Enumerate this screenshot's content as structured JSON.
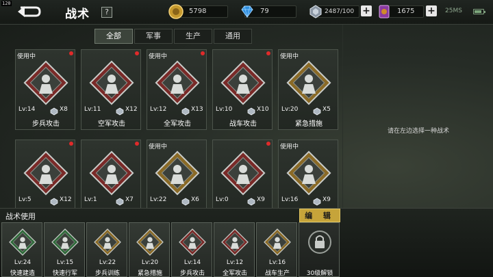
{
  "fps": "120",
  "header": {
    "title": "战术",
    "help": "?",
    "gold": "5798",
    "diamond": "79",
    "energy": "2487/100",
    "cards": "1675",
    "signal": "25MS"
  },
  "tabs": [
    {
      "label": "全部",
      "active": true
    },
    {
      "label": "军事",
      "active": false
    },
    {
      "label": "生产",
      "active": false
    },
    {
      "label": "通用",
      "active": false
    }
  ],
  "tactics": [
    {
      "name": "步兵攻击",
      "level": "Lv:14",
      "count": "X8",
      "in_use": "使用中",
      "alert": true,
      "icon": "infantry-attack-icon",
      "frame": "red"
    },
    {
      "name": "空军攻击",
      "level": "Lv:11",
      "count": "X12",
      "in_use": "",
      "alert": true,
      "icon": "air-force-attack-icon",
      "frame": "red"
    },
    {
      "name": "全军攻击",
      "level": "Lv:12",
      "count": "X13",
      "in_use": "使用中",
      "alert": true,
      "icon": "all-army-attack-icon",
      "frame": "red"
    },
    {
      "name": "战车攻击",
      "level": "Lv:10",
      "count": "X10",
      "in_use": "",
      "alert": true,
      "icon": "tank-attack-icon",
      "frame": "red"
    },
    {
      "name": "紧急措施",
      "level": "Lv:20",
      "count": "X5",
      "in_use": "使用中",
      "alert": false,
      "icon": "emergency-measures-icon",
      "frame": "gold"
    },
    {
      "name": "",
      "level": "Lv:5",
      "count": "X12",
      "in_use": "",
      "alert": true,
      "icon": "tank-icon",
      "frame": "red"
    },
    {
      "name": "",
      "level": "Lv:1",
      "count": "X7",
      "in_use": "",
      "alert": true,
      "icon": "naval-icon",
      "frame": "red"
    },
    {
      "name": "",
      "level": "Lv:22",
      "count": "X6",
      "in_use": "使用中",
      "alert": false,
      "icon": "running-soldier-icon",
      "frame": "gold"
    },
    {
      "name": "",
      "level": "Lv:0",
      "count": "X9",
      "in_use": "",
      "alert": true,
      "icon": "warship-icon",
      "frame": "red"
    },
    {
      "name": "",
      "level": "Lv:16",
      "count": "X9",
      "in_use": "使用中",
      "alert": false,
      "icon": "armored-tank-icon",
      "frame": "gold"
    }
  ],
  "right_panel": {
    "hint": "请在左边选择一种战术"
  },
  "bottom": {
    "title": "战术使用",
    "edit_label": "编 辑",
    "slots": [
      {
        "name": "快速建造",
        "level": "Lv:24",
        "icon": "fast-build-icon",
        "frame": "green"
      },
      {
        "name": "快速行军",
        "level": "Lv:15",
        "icon": "fast-march-icon",
        "frame": "green"
      },
      {
        "name": "步兵训练",
        "level": "Lv:22",
        "icon": "infantry-training-icon",
        "frame": "gold"
      },
      {
        "name": "紧急措施",
        "level": "Lv:20",
        "icon": "emergency-measures-icon",
        "frame": "gold"
      },
      {
        "name": "步兵攻击",
        "level": "Lv:14",
        "icon": "infantry-attack-icon",
        "frame": "red"
      },
      {
        "name": "全军攻击",
        "level": "Lv:12",
        "icon": "all-army-attack-icon",
        "frame": "red"
      },
      {
        "name": "战车生产",
        "level": "Lv:16",
        "icon": "tank-production-icon",
        "frame": "gold"
      },
      {
        "name": "30级解锁",
        "level": "",
        "icon": "lock-icon",
        "frame": "locked"
      }
    ]
  },
  "colors": {
    "red_frame": "#7a2a28",
    "gold_frame": "#8a6a26",
    "green_frame": "#2f6a3a",
    "alert": "#e02a2a",
    "edit_button": "#c6a43a"
  }
}
